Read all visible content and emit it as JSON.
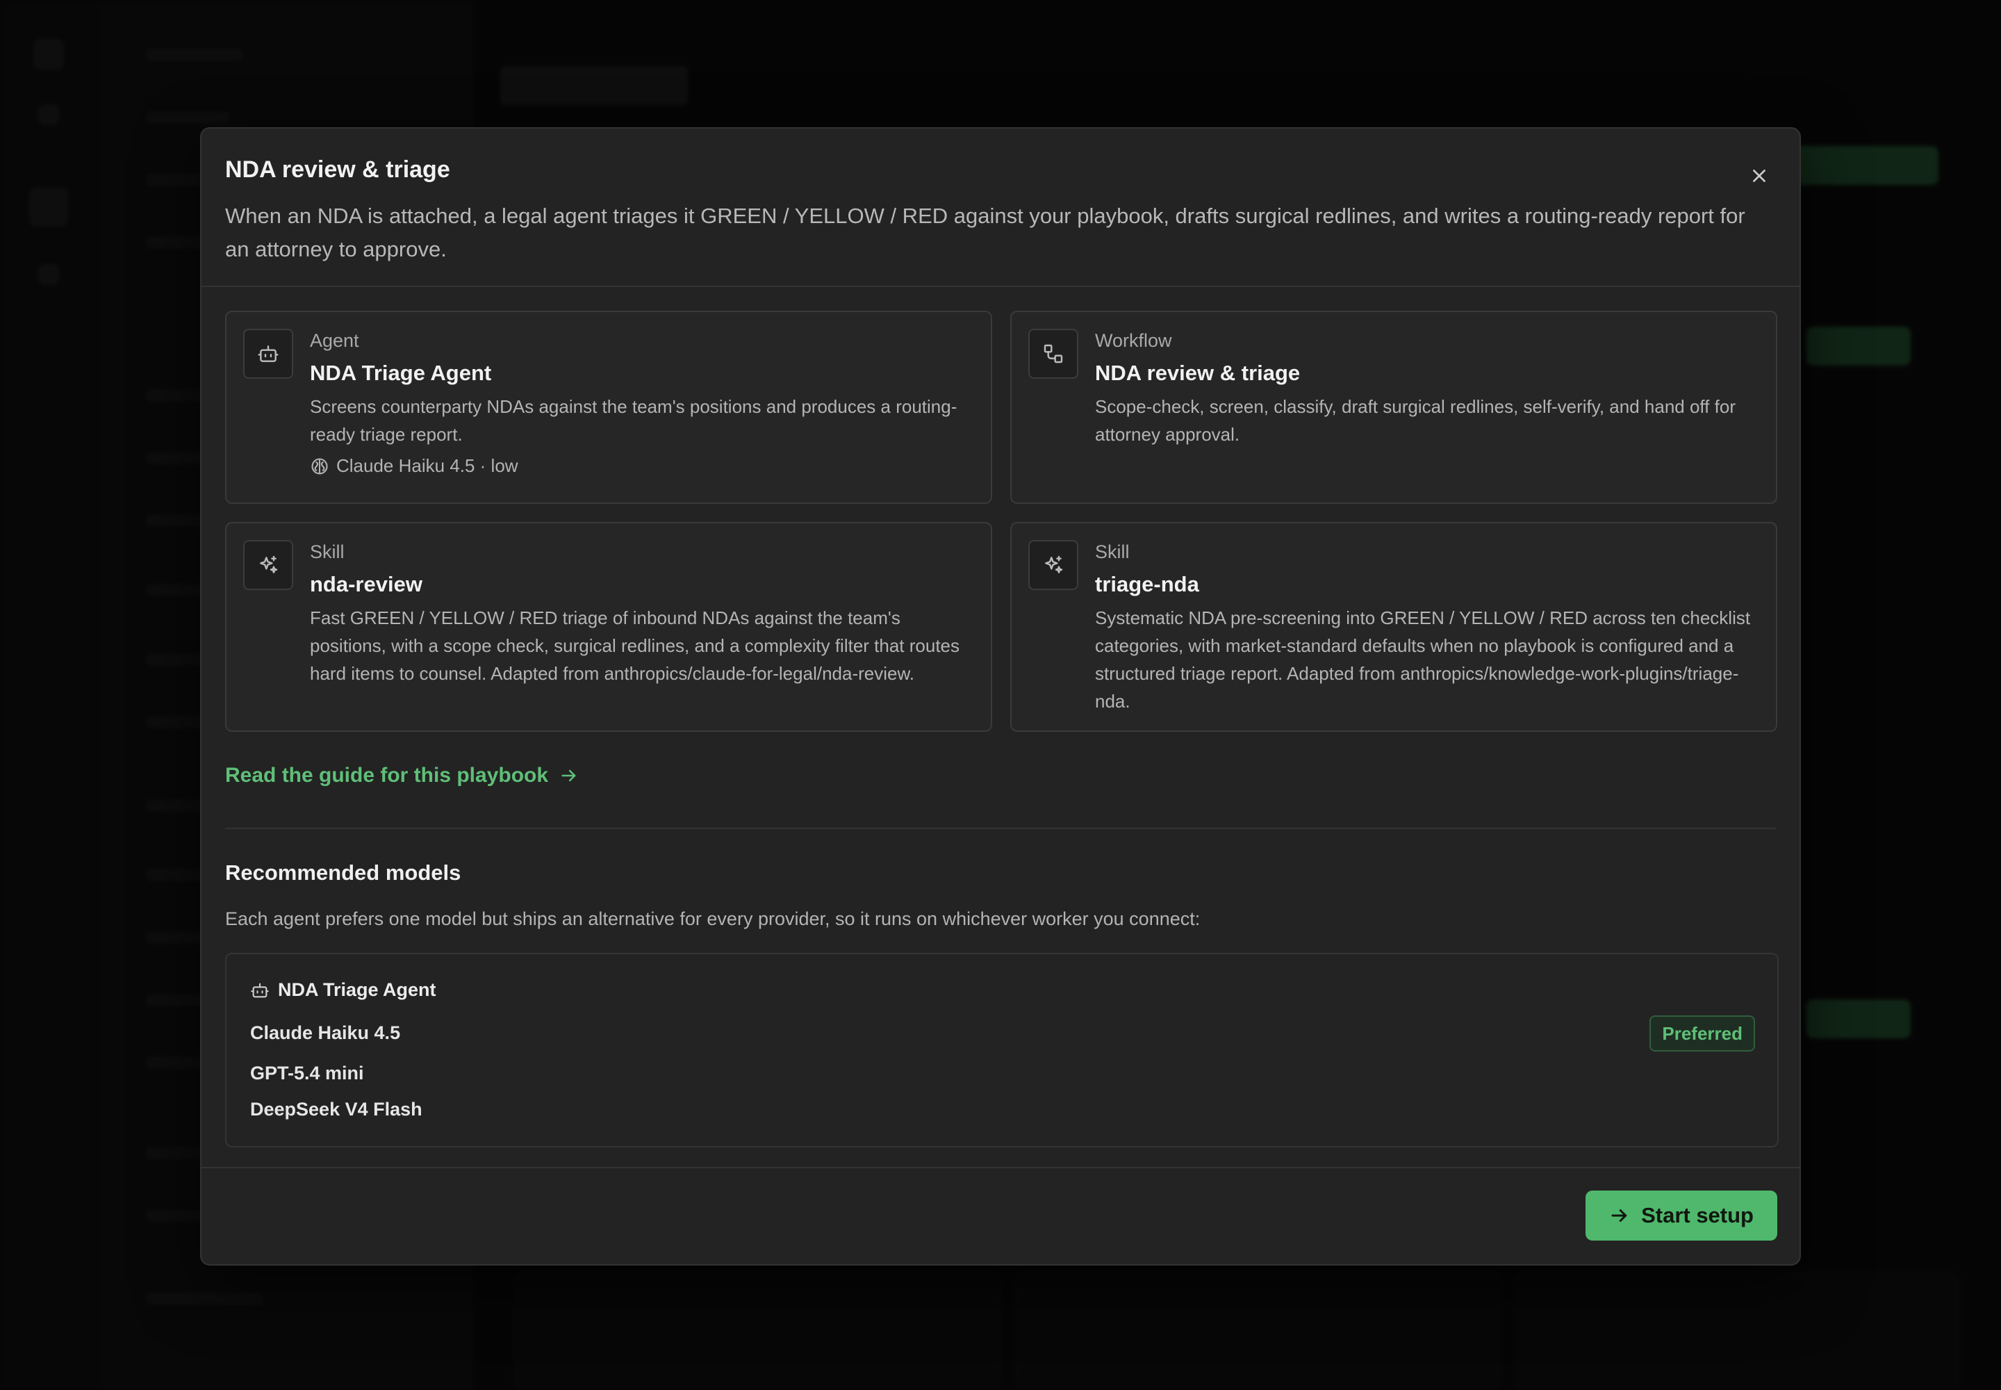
{
  "modal": {
    "title": "NDA review & triage",
    "description": "When an NDA is attached, a legal agent triages it GREEN / YELLOW / RED against your playbook, drafts surgical redlines, and writes a routing-ready report for an attorney to approve.",
    "close_icon": "close-icon"
  },
  "cards": [
    {
      "kind": "Agent",
      "name": "NDA Triage Agent",
      "description": "Screens counterparty NDAs against the team's positions and produces a routing-ready triage report.",
      "meta": "Claude Haiku 4.5 · low",
      "icon": "robot-icon",
      "meta_icon": "model-icon"
    },
    {
      "kind": "Workflow",
      "name": "NDA review & triage",
      "description": "Scope-check, screen, classify, draft surgical redlines, self-verify, and hand off for attorney approval.",
      "icon": "workflow-icon"
    },
    {
      "kind": "Skill",
      "name": "nda-review",
      "description": "Fast GREEN / YELLOW / RED triage of inbound NDAs against the team's positions, with a scope check, surgical redlines, and a complexity filter that routes hard items to counsel. Adapted from anthropics/claude-for-legal/nda-review.",
      "icon": "sparkle-icon"
    },
    {
      "kind": "Skill",
      "name": "triage-nda",
      "description": "Systematic NDA pre-screening into GREEN / YELLOW / RED across ten checklist categories, with market-standard defaults when no playbook is configured and a structured triage report. Adapted from anthropics/knowledge-work-plugins/triage-nda.",
      "icon": "sparkle-icon"
    }
  ],
  "guide_link": "Read the guide for this playbook",
  "recommended": {
    "title": "Recommended models",
    "description": "Each agent prefers one model but ships an alternative for every provider, so it runs on whichever worker you connect:",
    "agent_name": "NDA Triage Agent",
    "models": [
      "Claude Haiku 4.5",
      "GPT-5.4 mini",
      "DeepSeek V4 Flash"
    ],
    "preferred_label": "Preferred"
  },
  "footer": {
    "start_label": "Start setup"
  },
  "colors": {
    "accent": "#4fb86c",
    "link": "#5fbf78",
    "modal_bg": "#232323"
  }
}
